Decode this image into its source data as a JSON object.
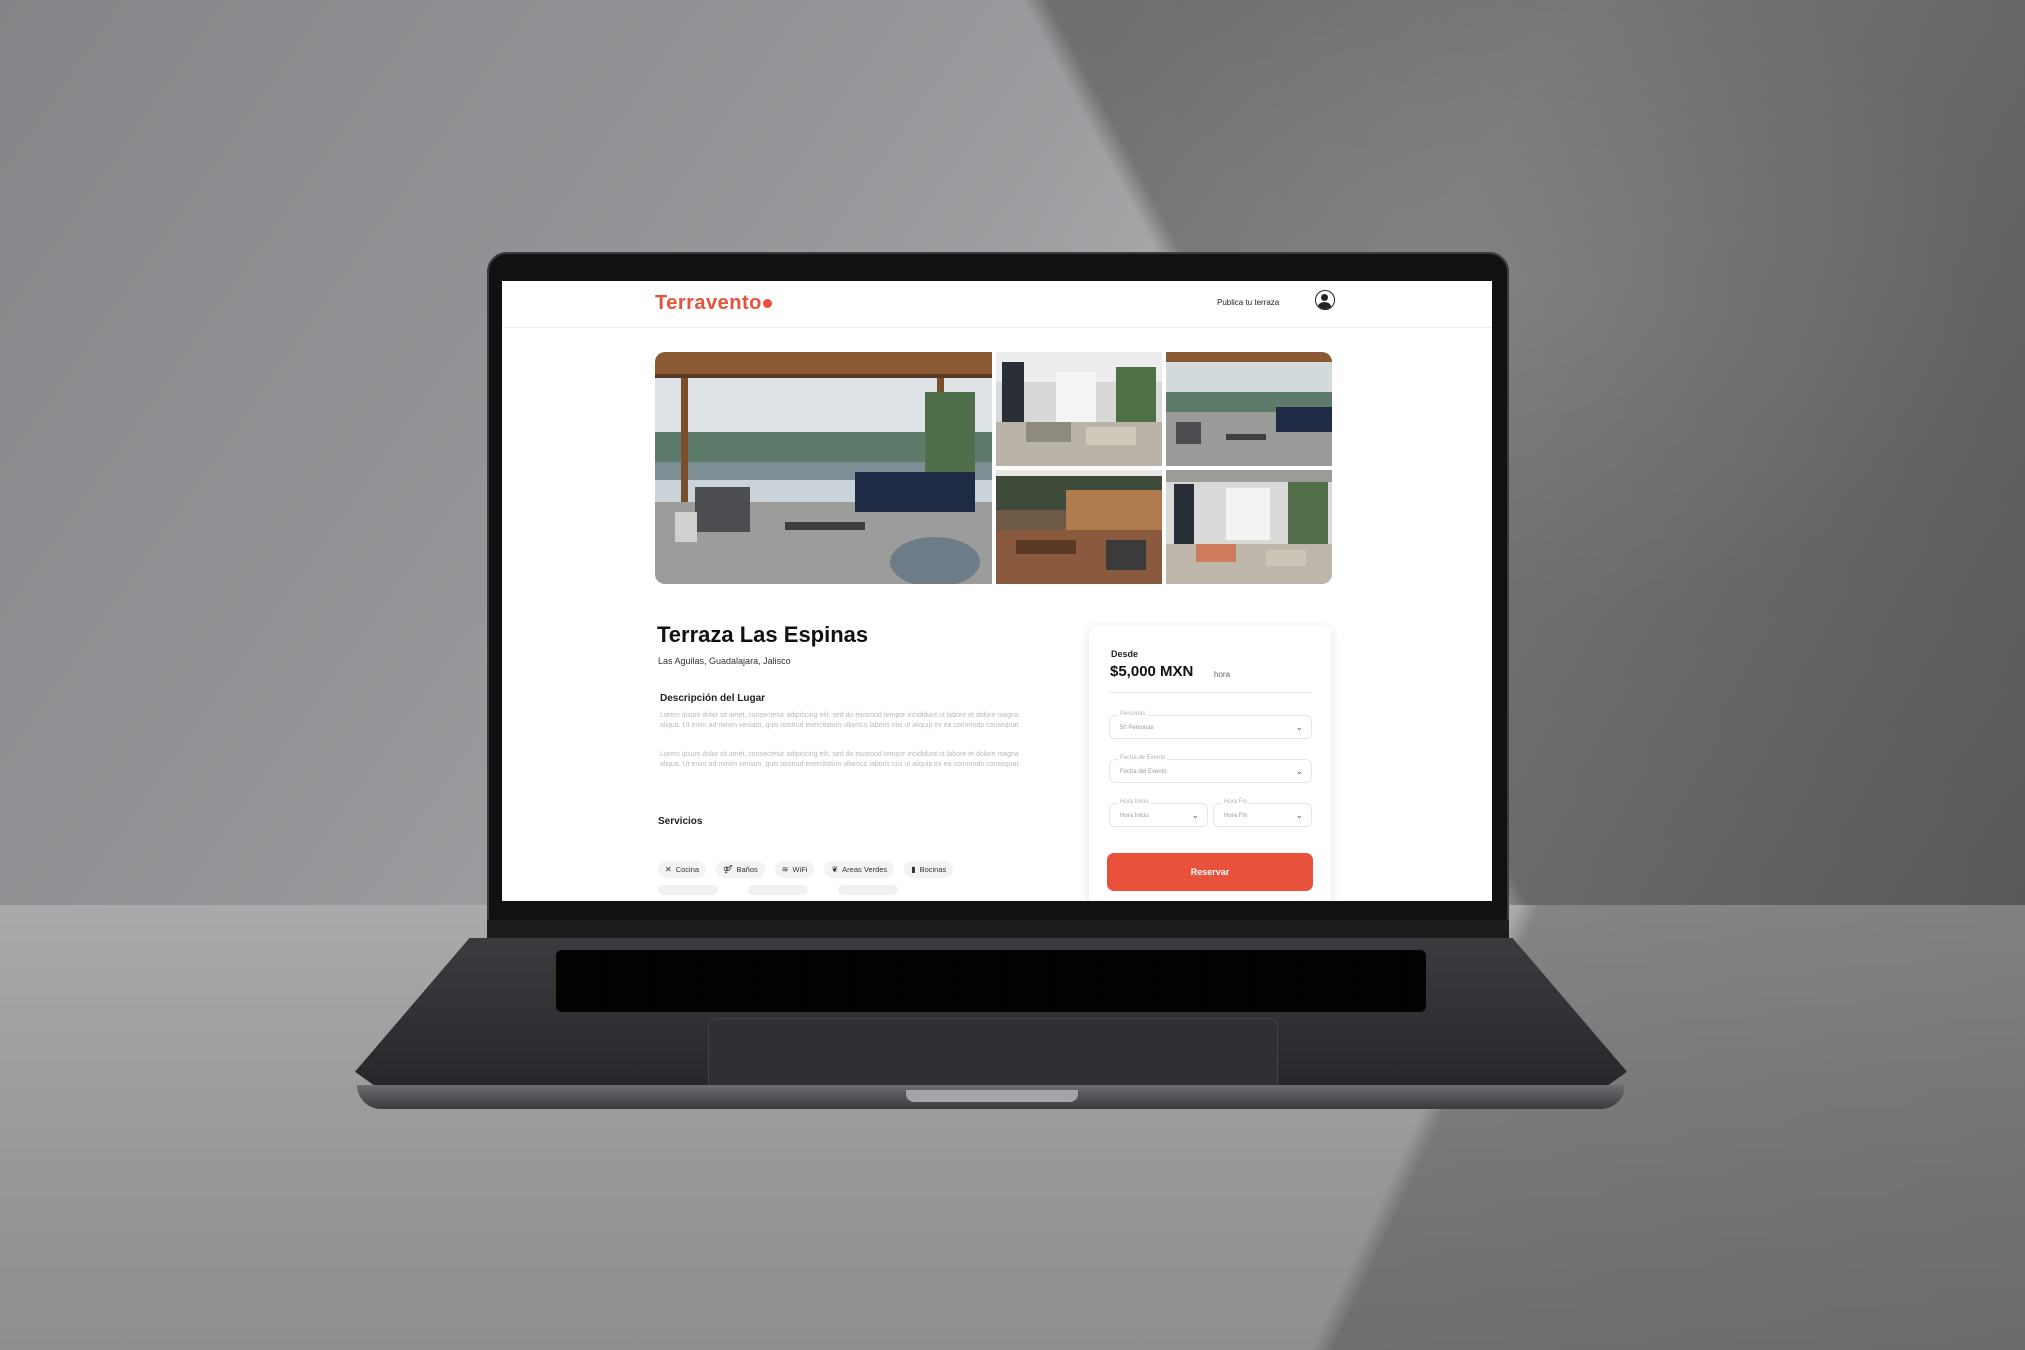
{
  "site": {
    "logo_text": "Terravento",
    "publish_link": "Publica tu terraza",
    "accent_color": "#e8513b"
  },
  "gallery": {
    "photos": [
      "terrace-lounge-photo",
      "courtyard-photo",
      "rooftop-sofa-photo",
      "bar-patio-photo",
      "courtyard-pergola-photo"
    ]
  },
  "listing": {
    "title": "Terraza Las Espinas",
    "location": "Las Aguilas, Guadalajara, Jalisco",
    "description_heading": "Descripción del Lugar",
    "description_paragraphs": [
      "Lorem ipsum dolor sit amet, consectetur adipiscing elit, sed do eiusmod tempor incididunt ut labore et dolore magna aliqua. Ut enim ad minim veniam, quis nostrud exercitation ullamco laboris nisi ut aliquip ex ea commodo consequat.",
      "Lorem ipsum dolor sit amet, consectetur adipiscing elit, sed do eiusmod tempor incididunt ut labore et dolore magna aliqua. Ut enim ad minim veniam, quis nostrud exercitation ullamco laboris nisi ut aliquip ex ea commodo consequat."
    ],
    "services_heading": "Servicios",
    "services": [
      {
        "label": "Cocina",
        "icon": "utensils-icon"
      },
      {
        "label": "Baños",
        "icon": "restroom-icon"
      },
      {
        "label": "WiFi",
        "icon": "wifi-icon"
      },
      {
        "label": "Areas Verdes",
        "icon": "leaf-icon"
      },
      {
        "label": "Bocinas",
        "icon": "speaker-icon"
      }
    ]
  },
  "booking": {
    "from_label": "Desde",
    "price": "$5,000 MXN",
    "price_unit": "hora",
    "fields": {
      "personas": {
        "label": "Personas",
        "value": "50 Personas"
      },
      "fecha": {
        "label": "Fecha de Evento",
        "value": "Fecha del Evento"
      },
      "hora_inicio": {
        "label": "Hora Inicio",
        "value": "Hora Inicio"
      },
      "hora_fin": {
        "label": "Hora Fin",
        "value": "Hora Fin"
      }
    },
    "reserve_button": "Reservar"
  }
}
